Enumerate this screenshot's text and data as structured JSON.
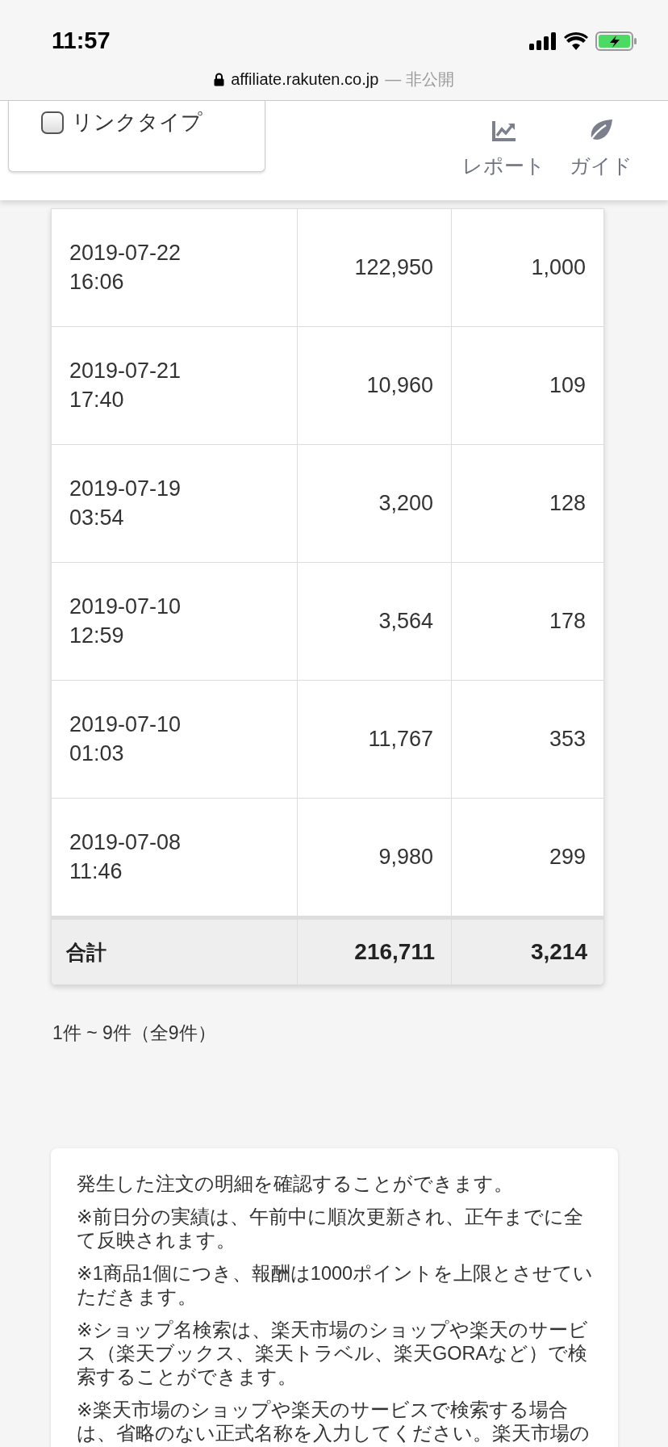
{
  "status_bar": {
    "time": "11:57",
    "url": "affiliate.rakuten.co.jp",
    "privacy": "— 非公開"
  },
  "dropdown": {
    "label": "リンクタイプ",
    "checked": false
  },
  "nav": [
    {
      "kind": "report",
      "label": "レポート"
    },
    {
      "kind": "guide",
      "label": "ガイド"
    }
  ],
  "table": {
    "rows": [
      {
        "column_1": "2019-07-22 16:06",
        "column_2": "122,950",
        "column_3": "1,000"
      },
      {
        "column_1": "2019-07-21 17:40",
        "column_2": "10,960",
        "column_3": "109"
      },
      {
        "column_1": "2019-07-19 03:54",
        "column_2": "3,200",
        "column_3": "128"
      },
      {
        "column_1": "2019-07-10 12:59",
        "column_2": "3,564",
        "column_3": "178"
      },
      {
        "column_1": "2019-07-10 01:03",
        "column_2": "11,767",
        "column_3": "353"
      },
      {
        "column_1": "2019-07-08 11:46",
        "column_2": "9,980",
        "column_3": "299"
      }
    ],
    "total": {
      "label": "合計",
      "column_2": "216,711",
      "column_3": "3,214"
    }
  },
  "pagination": "1件 ~ 9件（全9件）",
  "notes": [
    "発生した注文の明細を確認することができます。",
    "※前日分の実績は、午前中に順次更新され、正午までに全て反映されます。",
    "※1商品1個につき、報酬は1000ポイントを上限とさせていただきます。",
    "※ショップ名検索は、楽天市場のショップや楽天のサービス（楽天ブックス、楽天トラベル、楽天GORAなど）で検索することができます。",
    "※楽天市場のショップや楽天のサービスで検索する場合は、省略のない正式名称を入力してください。楽天市場の"
  ]
}
